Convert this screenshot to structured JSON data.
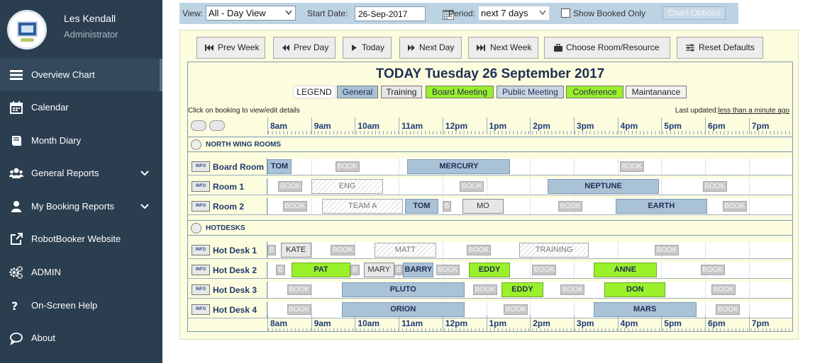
{
  "sidebar": {
    "user_name": "Les Kendall",
    "user_role": "Administrator",
    "items": [
      {
        "label": "Overview Chart",
        "icon": "chart-bars-icon"
      },
      {
        "label": "Calendar",
        "icon": "calendar-icon"
      },
      {
        "label": "Month Diary",
        "icon": "book-icon"
      },
      {
        "label": "General Reports",
        "icon": "users-icon",
        "has_submenu": true
      },
      {
        "label": "My Booking Reports",
        "icon": "user-icon",
        "has_submenu": true
      },
      {
        "label": "RobotBooker Website",
        "icon": "external-link-icon"
      },
      {
        "label": "ADMIN",
        "icon": "gears-icon"
      },
      {
        "label": "On-Screen Help",
        "icon": "question-icon"
      },
      {
        "label": "About",
        "icon": "speech-bubble-icon"
      }
    ],
    "active_item": "Overview Chart"
  },
  "toolbar": {
    "view_label": "View:",
    "view_value": "All - Day View",
    "start_date_label": "Start Date:",
    "start_date_value": "26-Sep-2017",
    "period_label": "Period:",
    "period_value": "next 7 days",
    "show_booked_label": "Show Booked Only",
    "show_booked_checked": false,
    "chart_options_label": "Chart Options"
  },
  "nav_buttons": {
    "prev_week": "Prev Week",
    "prev_day": "Prev Day",
    "today": "Today",
    "next_day": "Next Day",
    "next_week": "Next Week",
    "choose_room": "Choose Room/Resource",
    "reset_defaults": "Reset Defaults"
  },
  "chart": {
    "title": "TODAY Tuesday 26 September 2017",
    "legend_title": "LEGEND",
    "legend": [
      {
        "label": "General",
        "color": "#a9c2d6"
      },
      {
        "label": "Training",
        "color": "#e6e6e6"
      },
      {
        "label": "Board Meeting",
        "color": "#9af02a"
      },
      {
        "label": "Public Meeting",
        "color": "#c9d6e2"
      },
      {
        "label": "Conference",
        "color": "#9af02a"
      },
      {
        "label": "Maintanance",
        "color": "#f2f2f2"
      }
    ],
    "click_note": "Click on booking to view/edit details",
    "last_updated_label": "Last updated:",
    "last_updated_value": "less than a minute ago",
    "info_label": "INFO",
    "hours": [
      "8am",
      "9am",
      "10am",
      "11am",
      "12pm",
      "1pm",
      "2pm",
      "3pm",
      "4pm",
      "5pm",
      "6pm",
      "7pm"
    ],
    "sections": [
      {
        "title": "NORTH WING ROOMS",
        "rooms": [
          {
            "name": "Board Room",
            "bookings": [
              {
                "label": "TOM",
                "start": 8.0,
                "end": 8.55,
                "kind": "general"
              },
              {
                "label": "BOOK",
                "start": 9.55,
                "end": 10.1,
                "kind": "book"
              },
              {
                "label": "MERCURY",
                "start": 11.2,
                "end": 13.55,
                "kind": "general"
              },
              {
                "label": "BOOK",
                "start": 16.05,
                "end": 16.6,
                "kind": "book"
              }
            ]
          },
          {
            "name": "Room 1",
            "bookings": [
              {
                "label": "BOOK",
                "start": 8.25,
                "end": 8.8,
                "kind": "book"
              },
              {
                "label": "ENG",
                "start": 9.0,
                "end": 10.65,
                "kind": "training"
              },
              {
                "label": "BOOK",
                "start": 12.4,
                "end": 12.95,
                "kind": "book"
              },
              {
                "label": "NEPTUNE",
                "start": 14.4,
                "end": 16.95,
                "kind": "general"
              },
              {
                "label": "BOOK",
                "start": 17.95,
                "end": 18.5,
                "kind": "book"
              }
            ]
          },
          {
            "name": "Room 2",
            "bookings": [
              {
                "label": "BOOK",
                "start": 8.35,
                "end": 8.9,
                "kind": "book"
              },
              {
                "label": "TEAM A",
                "start": 9.25,
                "end": 11.1,
                "kind": "training"
              },
              {
                "label": "TOM",
                "start": 11.15,
                "end": 11.9,
                "kind": "general"
              },
              {
                "label": "B",
                "start": 12.0,
                "end": 12.2,
                "kind": "b"
              },
              {
                "label": "MO",
                "start": 12.45,
                "end": 13.4,
                "kind": "grey"
              },
              {
                "label": "BOOK",
                "start": 14.65,
                "end": 15.2,
                "kind": "book"
              },
              {
                "label": "EARTH",
                "start": 15.95,
                "end": 18.05,
                "kind": "general"
              },
              {
                "label": "BOOK",
                "start": 18.4,
                "end": 18.95,
                "kind": "book"
              }
            ]
          }
        ]
      },
      {
        "title": "HOTDESKS",
        "rooms": [
          {
            "name": "Hot Desk 1",
            "bookings": [
              {
                "label": "B",
                "start": 8.0,
                "end": 8.2,
                "kind": "b"
              },
              {
                "label": "KATE",
                "start": 8.3,
                "end": 9.0,
                "kind": "grey"
              },
              {
                "label": "BOOK",
                "start": 9.45,
                "end": 10.0,
                "kind": "book"
              },
              {
                "label": "MATT",
                "start": 10.45,
                "end": 11.85,
                "kind": "training"
              },
              {
                "label": "BOOK",
                "start": 12.55,
                "end": 13.1,
                "kind": "book"
              },
              {
                "label": "TRAINING",
                "start": 13.75,
                "end": 15.35,
                "kind": "training"
              },
              {
                "label": "BOOK",
                "start": 16.85,
                "end": 17.4,
                "kind": "book"
              }
            ]
          },
          {
            "name": "Hot Desk 2",
            "bookings": [
              {
                "label": "B",
                "start": 8.2,
                "end": 8.4,
                "kind": "b"
              },
              {
                "label": "PAT",
                "start": 8.55,
                "end": 9.9,
                "kind": "conf"
              },
              {
                "label": "B",
                "start": 9.9,
                "end": 10.1,
                "kind": "b"
              },
              {
                "label": "MARY",
                "start": 10.2,
                "end": 10.9,
                "kind": "grey"
              },
              {
                "label": "B",
                "start": 10.9,
                "end": 11.1,
                "kind": "b"
              },
              {
                "label": "BARRY",
                "start": 11.1,
                "end": 11.8,
                "kind": "general"
              },
              {
                "label": "BOOK",
                "start": 11.85,
                "end": 12.4,
                "kind": "book"
              },
              {
                "label": "EDDY",
                "start": 12.6,
                "end": 13.55,
                "kind": "conf"
              },
              {
                "label": "BOOK",
                "start": 14.05,
                "end": 14.6,
                "kind": "book"
              },
              {
                "label": "ANNE",
                "start": 15.45,
                "end": 16.9,
                "kind": "conf"
              },
              {
                "label": "BOOK",
                "start": 17.9,
                "end": 18.45,
                "kind": "book"
              }
            ]
          },
          {
            "name": "Hot Desk 3",
            "bookings": [
              {
                "label": "BOOK",
                "start": 8.45,
                "end": 9.0,
                "kind": "book"
              },
              {
                "label": "PLUTO",
                "start": 9.7,
                "end": 12.5,
                "kind": "general"
              },
              {
                "label": "BOOK",
                "start": 12.7,
                "end": 13.25,
                "kind": "book"
              },
              {
                "label": "EDDY",
                "start": 13.35,
                "end": 14.3,
                "kind": "conf"
              },
              {
                "label": "BOOK",
                "start": 14.7,
                "end": 15.25,
                "kind": "book"
              },
              {
                "label": "DON",
                "start": 15.7,
                "end": 17.1,
                "kind": "conf"
              },
              {
                "label": "BOOK",
                "start": 18.15,
                "end": 18.7,
                "kind": "book"
              }
            ]
          },
          {
            "name": "Hot Desk 4",
            "bookings": [
              {
                "label": "BOOK",
                "start": 8.45,
                "end": 9.0,
                "kind": "book"
              },
              {
                "label": "ORION",
                "start": 9.7,
                "end": 12.5,
                "kind": "general"
              },
              {
                "label": "BOOK",
                "start": 13.4,
                "end": 13.95,
                "kind": "book"
              },
              {
                "label": "MARS",
                "start": 15.45,
                "end": 17.8,
                "kind": "general"
              },
              {
                "label": "BOOK",
                "start": 18.25,
                "end": 18.8,
                "kind": "book"
              }
            ]
          }
        ]
      }
    ]
  }
}
